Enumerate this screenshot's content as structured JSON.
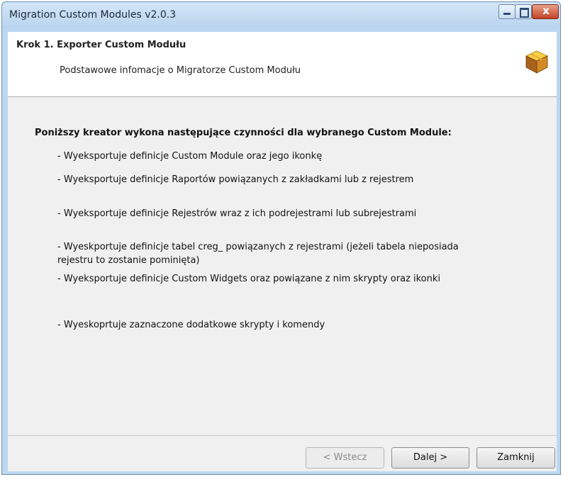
{
  "window": {
    "title": "Migration Custom Modules v2.0.3",
    "close_glyph": "x"
  },
  "header": {
    "step_title": "Krok 1. Exporter Custom Modułu",
    "step_description": "Podstawowe infomacje o Migratorze Custom Modułu",
    "icon": "package-box-icon"
  },
  "body": {
    "intro": "Poniższy kreator wykona następujące czynności dla wybranego Custom Module:",
    "items": [
      "- Wyeksportuje definicje Custom Module oraz jego ikonkę",
      "- Wyeksportuje definicje Raportów powiązanych z zakładkami lub z rejestrem",
      "- Wyeksportuje definicje Rejestrów wraz z ich podrejestrami lub subrejestrami",
      "- Wyeskportuje definicje tabel creg_ powiązanych z rejestrami (jeżeli tabela nieposiada rejestru to zostanie pominięta)",
      "- Wyeksportuje definicje Custom Widgets oraz powiązane z nim skrypty oraz ikonki",
      "- Wyeskoprtuje zaznaczone dodatkowe skrypty i komendy"
    ]
  },
  "footer": {
    "back_label": "< Wstecz",
    "next_label": "Dalej >",
    "close_label": "Zamknij"
  },
  "colors": {
    "titlebar": "#bcd7f2",
    "close_button": "#c34327",
    "body_background": "#f0f0f0"
  }
}
